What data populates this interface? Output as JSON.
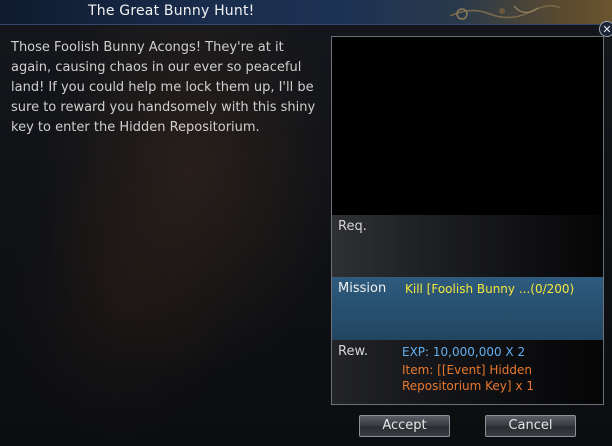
{
  "window": {
    "title": "The Great Bunny Hunt!",
    "close_glyph": "✕"
  },
  "dialogue": {
    "text": "Those Foolish Bunny Acongs! They're at it again, causing chaos in our ever so peaceful land! If you could help me lock them up, I'll be sure to reward you handsomely with this shiny key to enter the Hidden Repositorium."
  },
  "quest": {
    "req_label": "Req.",
    "mission_label": "Mission",
    "mission_text": "Kill [Foolish Bunny ...(0/200)",
    "reward_label": "Rew.",
    "reward_exp": "EXP: 10,000,000 X 2",
    "reward_item": "Item: [[Event] Hidden Repositorium Key] x 1"
  },
  "buttons": {
    "accept": "Accept",
    "cancel": "Cancel"
  },
  "colors": {
    "mission_text": "#f4e83a",
    "exp_text": "#63aef0",
    "item_text": "#e8782e",
    "mission_row": "#27506f",
    "titlebar": "#1a2d4d"
  }
}
